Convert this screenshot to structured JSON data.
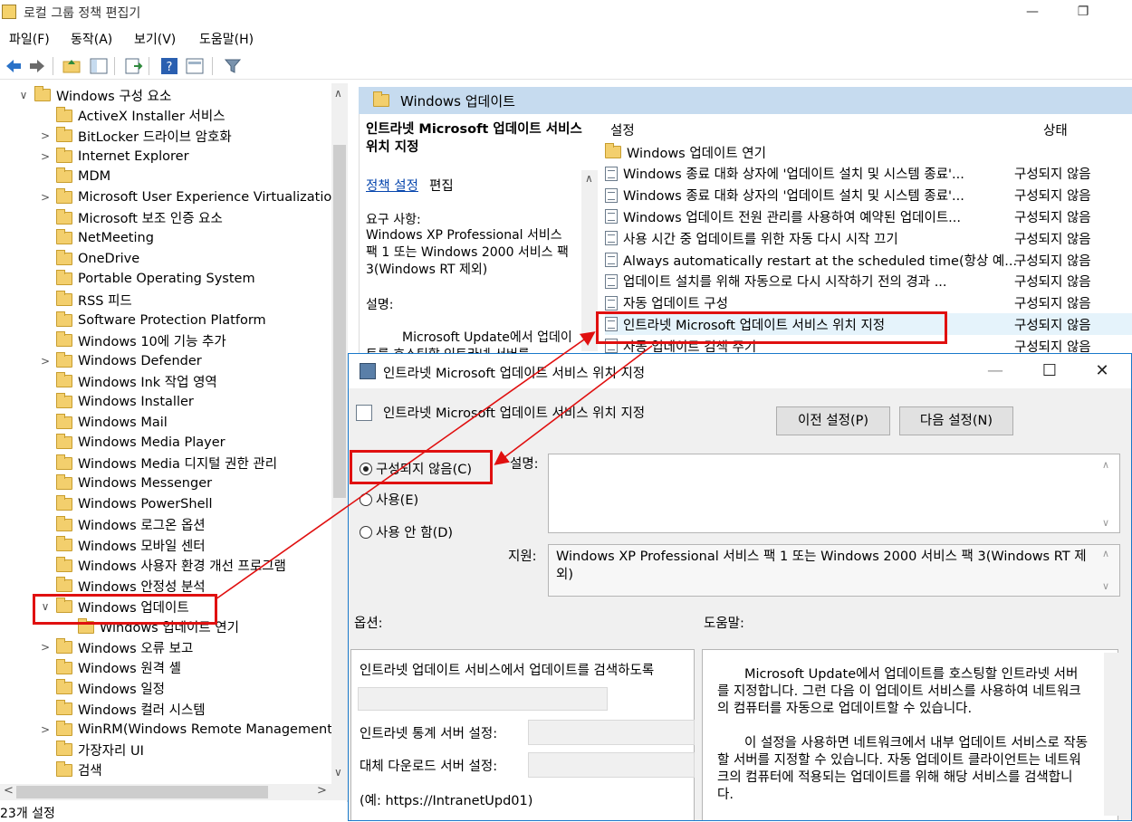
{
  "window": {
    "title": "로컬 그룹 정책 편집기",
    "minimize": "—",
    "maximize": "❐"
  },
  "menu": [
    "파일(F)",
    "동작(A)",
    "보기(V)",
    "도움말(H)"
  ],
  "tree": [
    {
      "label": "Windows 구성 요소",
      "chev": "∨",
      "indent": 0
    },
    {
      "label": "ActiveX Installer 서비스",
      "chev": "",
      "indent": 1
    },
    {
      "label": "BitLocker 드라이브 암호화",
      "chev": ">",
      "indent": 1
    },
    {
      "label": "Internet Explorer",
      "chev": ">",
      "indent": 1
    },
    {
      "label": "MDM",
      "chev": "",
      "indent": 1
    },
    {
      "label": "Microsoft User Experience Virtualization",
      "chev": ">",
      "indent": 1
    },
    {
      "label": "Microsoft 보조 인증 요소",
      "chev": "",
      "indent": 1
    },
    {
      "label": "NetMeeting",
      "chev": "",
      "indent": 1
    },
    {
      "label": "OneDrive",
      "chev": "",
      "indent": 1
    },
    {
      "label": "Portable Operating System",
      "chev": "",
      "indent": 1
    },
    {
      "label": "RSS 피드",
      "chev": "",
      "indent": 1
    },
    {
      "label": "Software Protection Platform",
      "chev": "",
      "indent": 1
    },
    {
      "label": "Windows 10에 기능 추가",
      "chev": "",
      "indent": 1
    },
    {
      "label": "Windows Defender",
      "chev": ">",
      "indent": 1
    },
    {
      "label": "Windows Ink 작업 영역",
      "chev": "",
      "indent": 1
    },
    {
      "label": "Windows Installer",
      "chev": "",
      "indent": 1
    },
    {
      "label": "Windows Mail",
      "chev": "",
      "indent": 1
    },
    {
      "label": "Windows Media Player",
      "chev": "",
      "indent": 1
    },
    {
      "label": "Windows Media 디지털 권한 관리",
      "chev": "",
      "indent": 1
    },
    {
      "label": "Windows Messenger",
      "chev": "",
      "indent": 1
    },
    {
      "label": "Windows PowerShell",
      "chev": "",
      "indent": 1
    },
    {
      "label": "Windows 로그온 옵션",
      "chev": "",
      "indent": 1
    },
    {
      "label": "Windows 모바일 센터",
      "chev": "",
      "indent": 1
    },
    {
      "label": "Windows 사용자 환경 개선 프로그램",
      "chev": "",
      "indent": 1
    },
    {
      "label": "Windows 안정성 분석",
      "chev": "",
      "indent": 1
    },
    {
      "label": "Windows 업데이트",
      "chev": "∨",
      "indent": 1
    },
    {
      "label": "Windows 업데이트 연기",
      "chev": "",
      "indent": 2
    },
    {
      "label": "Windows 오류 보고",
      "chev": ">",
      "indent": 1
    },
    {
      "label": "Windows 원격 셸",
      "chev": "",
      "indent": 1
    },
    {
      "label": "Windows 일정",
      "chev": "",
      "indent": 1
    },
    {
      "label": "Windows 컬러 시스템",
      "chev": "",
      "indent": 1
    },
    {
      "label": "WinRM(Windows Remote Management)",
      "chev": ">",
      "indent": 1
    },
    {
      "label": "가장자리 UI",
      "chev": "",
      "indent": 1
    },
    {
      "label": "검색",
      "chev": "",
      "indent": 1
    }
  ],
  "status": "23개 설정",
  "right": {
    "header": "Windows 업데이트",
    "desc_title": "인트라넷 Microsoft 업데이트 서비스 위치 지정",
    "policy_link": "정책 설정",
    "policy_edit": "편집",
    "req_label": "요구 사항:",
    "req_text": "Windows XP Professional 서비스 팩 1 또는 Windows 2000 서비스 팩 3(Windows RT 제외)",
    "desc_label": "설명:",
    "desc_snippet": "Microsoft Update에서 업데이트를 호스팅할 인트라넷 서버를",
    "col_setting": "설정",
    "col_state": "상태",
    "rows": [
      {
        "name": "Windows 업데이트 연기",
        "state": "",
        "folder": true
      },
      {
        "name": "Windows 종료 대화 상자에 '업데이트 설치 및 시스템 종료'...",
        "state": "구성되지 않음"
      },
      {
        "name": "Windows 종료 대화 상자의 '업데이트 설치 및 시스템 종료'...",
        "state": "구성되지 않음"
      },
      {
        "name": "Windows 업데이트 전원 관리를 사용하여 예약된 업데이트...",
        "state": "구성되지 않음"
      },
      {
        "name": "사용 시간 중 업데이트를 위한 자동 다시 시작 끄기",
        "state": "구성되지 않음"
      },
      {
        "name": "Always automatically restart at the scheduled time(항상 예...",
        "state": "구성되지 않음"
      },
      {
        "name": "업데이트 설치를 위해 자동으로 다시 시작하기 전의 경과 ...",
        "state": "구성되지 않음"
      },
      {
        "name": "자동 업데이트 구성",
        "state": "구성되지 않음"
      },
      {
        "name": "인트라넷 Microsoft 업데이트 서비스 위치 지정",
        "state": "구성되지 않음"
      },
      {
        "name": "자동 업데이트 검색 주기",
        "state": "구성되지 않음"
      }
    ]
  },
  "dialog": {
    "title": "인트라넷 Microsoft 업데이트 서비스 위치 지정",
    "sub_title": "인트라넷 Microsoft 업데이트 서비스 위치 지정",
    "prev_button": "이전 설정(P)",
    "next_button": "다음 설정(N)",
    "radio_not_configured": "구성되지 않음(C)",
    "radio_enabled": "사용(E)",
    "radio_disabled": "사용 안 함(D)",
    "comment_label": "설명:",
    "support_label": "지원:",
    "support_text": "Windows XP Professional 서비스 팩 1 또는 Windows 2000 서비스 팩 3(Windows RT 제외)",
    "options_label": "옵션:",
    "help_label": "도움말:",
    "opt_line1": "인트라넷 업데이트 서비스에서 업데이트를 검색하도록",
    "opt_line2": "인트라넷 통계 서버 설정:",
    "opt_line3": "대체 다운로드 서버 설정:",
    "opt_line4": "(예: https://IntranetUpd01)",
    "help_p1": "Microsoft Update에서 업데이트를 호스팅할 인트라넷 서버를 지정합니다. 그런 다음 이 업데이트 서비스를 사용하여 네트워크의 컴퓨터를 자동으로 업데이트할 수 있습니다.",
    "help_p2": "이 설정을 사용하면 네트워크에서 내부 업데이트 서비스로 작동할 서버를 지정할 수 있습니다. 자동 업데이트 클라이언트는 네트워크의 컴퓨터에 적용되는 업데이트를 위해 해당 서비스를 검색합니다."
  },
  "colors": {
    "annotation": "#e01010",
    "header_bg": "#c6dbef",
    "dialog_border": "#1979ca"
  }
}
